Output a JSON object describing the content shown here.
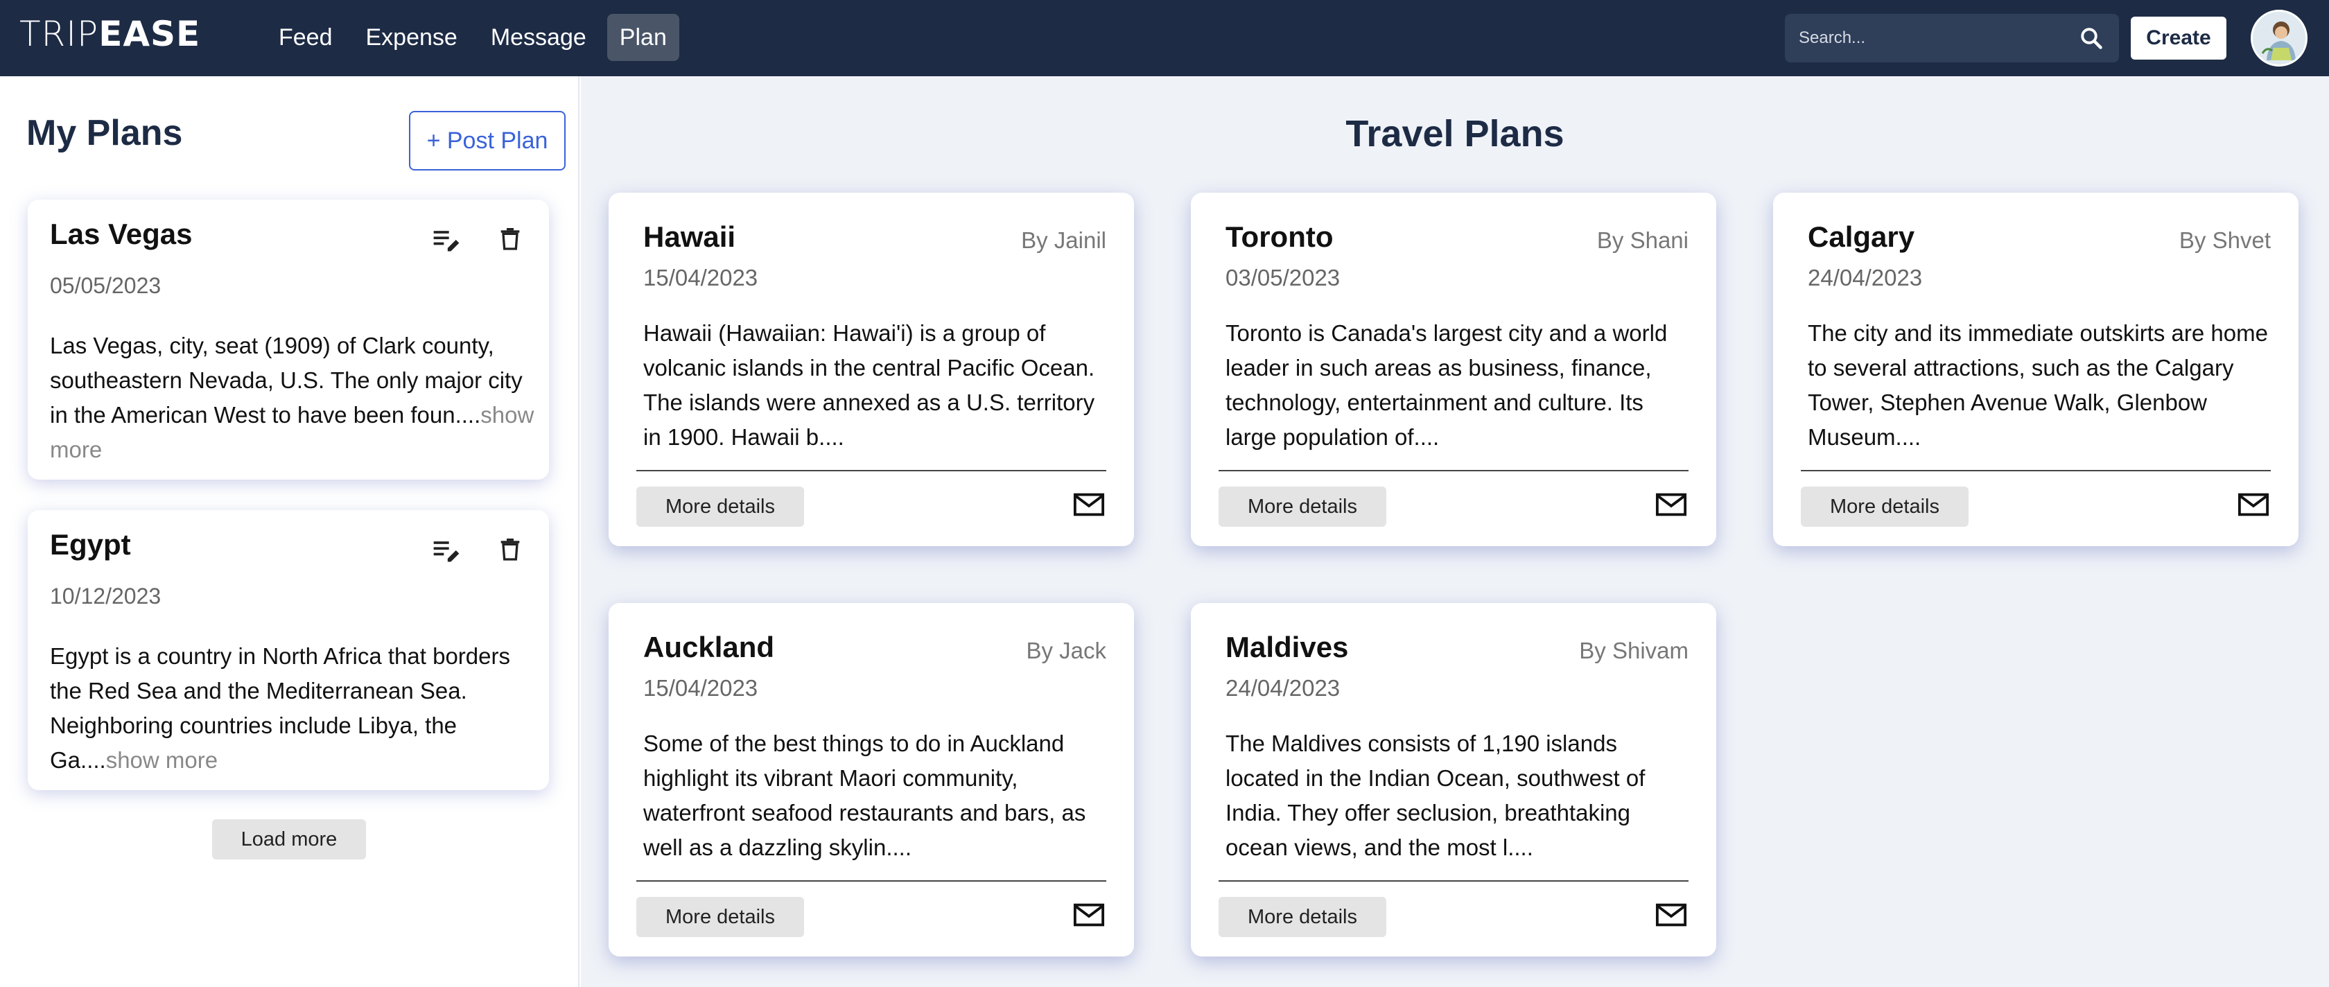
{
  "nav": {
    "logo_light": "TRIP",
    "logo_bold": "EASE",
    "links": [
      {
        "label": "Feed"
      },
      {
        "label": "Expense"
      },
      {
        "label": "Message"
      },
      {
        "label": "Plan",
        "active": true
      }
    ],
    "search_placeholder": "Search...",
    "create_label": "Create",
    "search_icon": "search-icon",
    "avatar_icon": "avatar"
  },
  "my_plans": {
    "title": "My Plans",
    "post_label": "+ Post Plan",
    "cards": [
      {
        "title": "Las Vegas",
        "date": "05/05/2023",
        "desc": "Las Vegas, city, seat (1909) of Clark county, southeastern Nevada, U.S. The only major city in the American West to have been foun....",
        "show_more": "show more"
      },
      {
        "title": "Egypt",
        "date": "10/12/2023",
        "desc": "Egypt is a country in North Africa that borders the Red Sea and the Mediterranean Sea. Neighboring countries include Libya, the Ga....",
        "show_more": "show more"
      }
    ],
    "load_more_label": "Load more"
  },
  "travel_plans": {
    "title": "Travel Plans",
    "more_label": "More details",
    "cards": [
      {
        "title": "Hawaii",
        "author": "By Jainil",
        "date": "15/04/2023",
        "desc": "Hawaii (Hawaiian: Hawai'i) is a group of volcanic islands in the central Pacific Ocean. The islands were annexed as a U.S. territory in 1900. Hawaii b...."
      },
      {
        "title": "Toronto",
        "author": "By Shani",
        "date": "03/05/2023",
        "desc": "Toronto is Canada's largest city and a world leader in such areas as business, finance, technology, entertainment and culture. Its large population of...."
      },
      {
        "title": "Calgary",
        "author": "By Shvet",
        "date": "24/04/2023",
        "desc": "The city and its immediate outskirts are home to several attractions, such as the Calgary Tower, Stephen Avenue Walk, Glenbow Museum...."
      },
      {
        "title": "Auckland",
        "author": "By Jack",
        "date": "15/04/2023",
        "desc": "Some of the best things to do in Auckland highlight its vibrant Maori community, waterfront seafood restaurants and bars, as well as a dazzling skylin...."
      },
      {
        "title": "Maldives",
        "author": "By Shivam",
        "date": "24/04/2023",
        "desc": "The Maldives consists of 1,190 islands located in the Indian Ocean, southwest of India. They offer seclusion, breathtaking ocean views, and the most l...."
      }
    ]
  },
  "colors": {
    "navbar": "#1d2b45",
    "accent": "#3a62d9",
    "panel_bg": "#eff2f7"
  }
}
